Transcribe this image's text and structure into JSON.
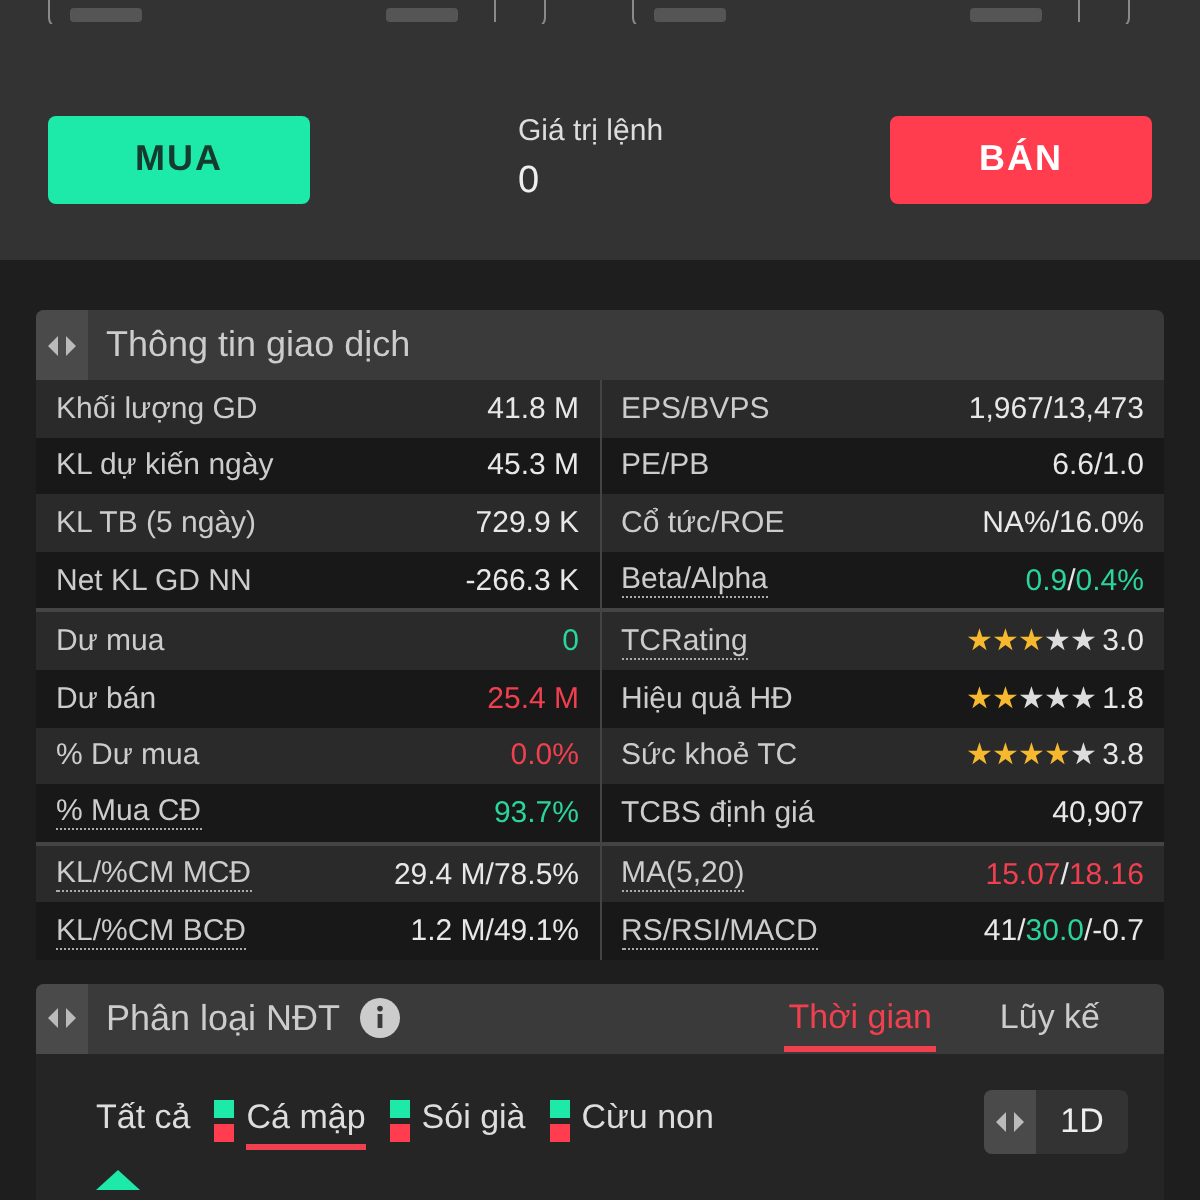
{
  "order": {
    "buy_label": "MUA",
    "value_label": "Giá trị lệnh",
    "value": "0",
    "sell_label": "BÁN"
  },
  "trade_info": {
    "title": "Thông tin giao dịch",
    "sections": [
      [
        [
          {
            "label": "Khối lượng GD",
            "dotted": false,
            "value": [
              {
                "text": "41.8 M",
                "color": "#e8e8e8"
              }
            ]
          },
          {
            "label": "EPS/BVPS",
            "dotted": false,
            "value": [
              {
                "text": "1,967/13,473",
                "color": "#e8e8e8"
              }
            ]
          }
        ],
        [
          {
            "label": "KL dự kiến ngày",
            "dotted": false,
            "value": [
              {
                "text": "45.3 M",
                "color": "#e8e8e8"
              }
            ]
          },
          {
            "label": "PE/PB",
            "dotted": false,
            "value": [
              {
                "text": "6.6/1.0",
                "color": "#e8e8e8"
              }
            ]
          }
        ],
        [
          {
            "label": "KL TB (5 ngày)",
            "dotted": false,
            "value": [
              {
                "text": "729.9 K",
                "color": "#e8e8e8"
              }
            ]
          },
          {
            "label": "Cổ tức/ROE",
            "dotted": false,
            "value": [
              {
                "text": "NA%/16.0%",
                "color": "#e8e8e8"
              }
            ]
          }
        ],
        [
          {
            "label": "Net KL GD NN",
            "dotted": false,
            "value": [
              {
                "text": "-266.3 K",
                "color": "#e8e8e8"
              }
            ]
          },
          {
            "label": "Beta/Alpha",
            "dotted": true,
            "value": [
              {
                "text": "0.9",
                "color": "#2bd49a"
              },
              {
                "text": "/",
                "color": "#e8e8e8"
              },
              {
                "text": "0.4%",
                "color": "#2bd49a"
              }
            ]
          }
        ]
      ],
      [
        [
          {
            "label": "Dư mua",
            "dotted": false,
            "value": [
              {
                "text": "0",
                "color": "#2bd49a"
              }
            ]
          },
          {
            "label": "TCRating",
            "dotted": true,
            "stars": 3,
            "value": [
              {
                "text": "3.0",
                "color": "#e8e8e8"
              }
            ]
          }
        ],
        [
          {
            "label": "Dư bán",
            "dotted": false,
            "value": [
              {
                "text": "25.4 M",
                "color": "#f0404f"
              }
            ]
          },
          {
            "label": "Hiệu quả HĐ",
            "dotted": false,
            "stars": 2,
            "value": [
              {
                "text": "1.8",
                "color": "#e8e8e8"
              }
            ]
          }
        ],
        [
          {
            "label": "% Dư mua",
            "dotted": false,
            "value": [
              {
                "text": "0.0%",
                "color": "#f0404f"
              }
            ]
          },
          {
            "label": "Sức khoẻ TC",
            "dotted": false,
            "stars": 4,
            "value": [
              {
                "text": "3.8",
                "color": "#e8e8e8"
              }
            ]
          }
        ],
        [
          {
            "label": "% Mua CĐ",
            "dotted": true,
            "value": [
              {
                "text": "93.7%",
                "color": "#2bd49a"
              }
            ]
          },
          {
            "label": "TCBS định giá",
            "dotted": false,
            "value": [
              {
                "text": "40,907",
                "color": "#e8e8e8"
              }
            ]
          }
        ]
      ],
      [
        [
          {
            "label": "KL/%CM MCĐ",
            "dotted": true,
            "value": [
              {
                "text": "29.4 M/78.5%",
                "color": "#e8e8e8"
              }
            ]
          },
          {
            "label": "MA(5,20)",
            "dotted": true,
            "value": [
              {
                "text": "15.07",
                "color": "#f0404f"
              },
              {
                "text": "/",
                "color": "#e8e8e8"
              },
              {
                "text": "18.16",
                "color": "#f0404f"
              }
            ]
          }
        ],
        [
          {
            "label": "KL/%CM BCĐ",
            "dotted": true,
            "value": [
              {
                "text": "1.2 M/49.1%",
                "color": "#e8e8e8"
              }
            ]
          },
          {
            "label": "RS/RSI/MACD",
            "dotted": true,
            "value": [
              {
                "text": "41",
                "color": "#e8e8e8"
              },
              {
                "text": "/",
                "color": "#e8e8e8"
              },
              {
                "text": "30.0",
                "color": "#2bd49a"
              },
              {
                "text": "/-0.7",
                "color": "#e8e8e8"
              }
            ]
          }
        ]
      ]
    ]
  },
  "investor_types": {
    "title": "Phân loại NĐT",
    "tabs": [
      {
        "label": "Thời gian",
        "selected": true
      },
      {
        "label": "Lũy kế",
        "selected": false
      }
    ],
    "filters": [
      {
        "label": "Tất cả",
        "kind": "plain",
        "selected": false
      },
      {
        "label": "Cá mập",
        "kind": "legend",
        "selected": true
      },
      {
        "label": "Sói già",
        "kind": "legend",
        "selected": false
      },
      {
        "label": "Cừu non",
        "kind": "legend",
        "selected": false
      }
    ],
    "period": "1D"
  }
}
